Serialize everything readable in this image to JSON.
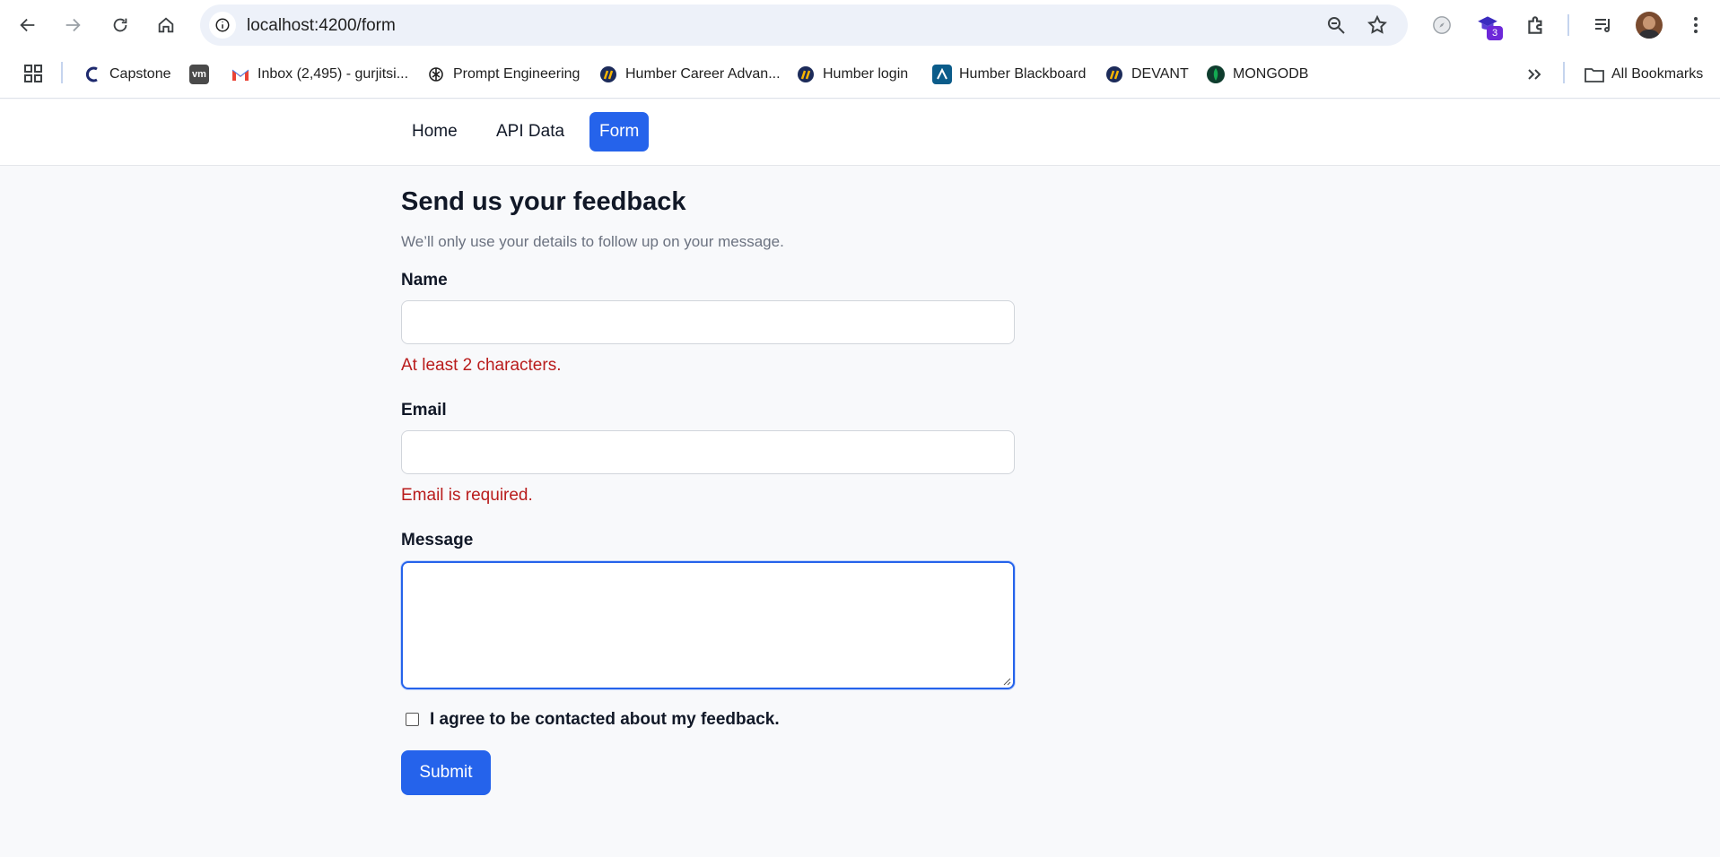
{
  "browser": {
    "url": "localhost:4200/form",
    "extension_badge": "3",
    "bookmarks": [
      {
        "label": "Capstone",
        "icon": "capstone-icon"
      },
      {
        "label": "",
        "icon": "vm-icon",
        "icon_text": "vm"
      },
      {
        "label": "Inbox (2,495) - gurjitsi...",
        "icon": "gmail-icon"
      },
      {
        "label": "Prompt Engineering",
        "icon": "openai-icon"
      },
      {
        "label": "Humber Career Advan...",
        "icon": "humber-icon"
      },
      {
        "label": "Humber login",
        "icon": "humber-icon"
      },
      {
        "label": "Humber Blackboard",
        "icon": "blackboard-icon"
      },
      {
        "label": "DEVANT",
        "icon": "humber-icon"
      },
      {
        "label": "MONGODB",
        "icon": "mongodb-icon"
      }
    ],
    "all_bookmarks": "All Bookmarks"
  },
  "nav": {
    "items": [
      {
        "label": "Home",
        "active": false
      },
      {
        "label": "API Data",
        "active": false
      },
      {
        "label": "Form",
        "active": true
      }
    ]
  },
  "form": {
    "title": "Send us your feedback",
    "subtitle": "We’ll only use your details to follow up on your message.",
    "name_label": "Name",
    "name_value": "",
    "name_error": "At least 2 characters.",
    "email_label": "Email",
    "email_value": "",
    "email_error": "Email is required.",
    "message_label": "Message",
    "message_value": "",
    "consent_label": "I agree to be contacted about my feedback.",
    "consent_checked": false,
    "submit_label": "Submit"
  },
  "colors": {
    "accent": "#2563eb",
    "error": "#b91c1c",
    "page_bg": "#f8f9fb"
  }
}
